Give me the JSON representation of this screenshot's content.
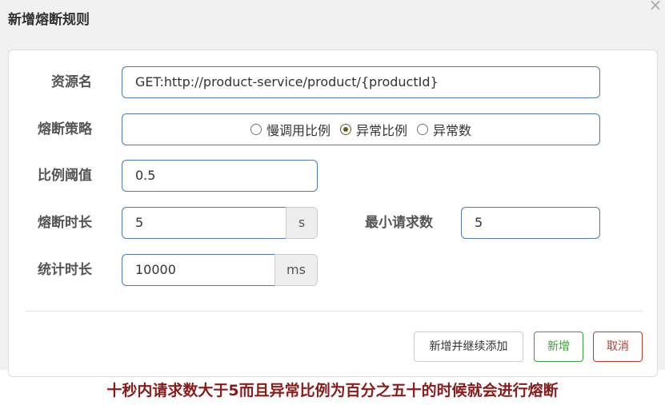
{
  "dialog": {
    "title": "新增熔断规则",
    "close_symbol": "×"
  },
  "form": {
    "resource": {
      "label": "资源名",
      "value": "GET:http://product-service/product/{productId}"
    },
    "strategy": {
      "label": "熔断策略",
      "options": [
        "慢调用比例",
        "异常比例",
        "异常数"
      ],
      "selected": "异常比例"
    },
    "ratio": {
      "label": "比例阈值",
      "value": "0.5"
    },
    "duration": {
      "label": "熔断时长",
      "value": "5",
      "unit": "s"
    },
    "min_requests": {
      "label": "最小请求数",
      "value": "5"
    },
    "stat_duration": {
      "label": "统计时长",
      "value": "10000",
      "unit": "ms"
    }
  },
  "buttons": {
    "add_continue": "新增并继续添加",
    "add": "新增",
    "cancel": "取消"
  },
  "caption": "十秒内请求数大于5而且异常比例为百分之五十的时候就会进行熔断",
  "colors": {
    "input_border": "#4a7ab8",
    "add_green": "#3c9a3c",
    "cancel_red": "#c0392b",
    "caption_red": "#8b1a1a"
  }
}
